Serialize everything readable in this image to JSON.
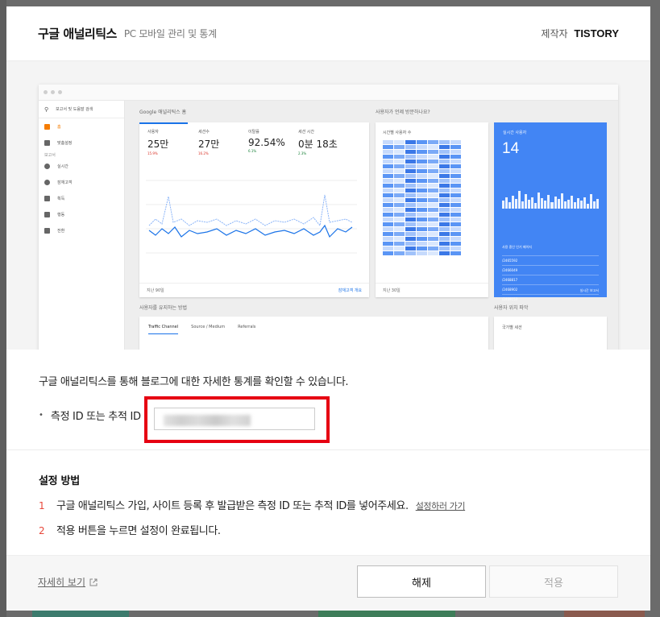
{
  "header": {
    "title": "구글 애널리틱스",
    "subtitle": "PC 모바일 관리 및 통계",
    "author_label": "제작자",
    "author_name": "TISTORY"
  },
  "preview": {
    "search_label": "보고서 및 도움말 검색",
    "side_items": [
      {
        "icon": "home-icon",
        "label": "홈"
      },
      {
        "icon": "customize-icon",
        "label": "맞춤설정"
      }
    ],
    "reports_label": "보고서",
    "report_items": [
      {
        "icon": "clock-icon",
        "label": "실시간"
      },
      {
        "icon": "person-icon",
        "label": "잠재고객"
      },
      {
        "icon": "acquisition-icon",
        "label": "획득"
      },
      {
        "icon": "behavior-icon",
        "label": "행동"
      },
      {
        "icon": "flag-icon",
        "label": "전환"
      }
    ],
    "home_title": "Google 애널리틱스 홈",
    "visit_title": "사용자가 언제 방문하나요?",
    "retain_title": "사용자를 유지하는 방법",
    "location_title": "사용자 위치 파악",
    "metrics": [
      {
        "label": "사용자",
        "value": "25만",
        "delta": "15.9%",
        "up": false
      },
      {
        "label": "세션수",
        "value": "27만",
        "delta": "16.2%",
        "up": false
      },
      {
        "label": "이탈률",
        "value": "92.54%",
        "delta": "6.1%",
        "up": true
      },
      {
        "label": "세션 시간",
        "value": "0분 18초",
        "delta": "2.3%",
        "up": true
      }
    ],
    "home_period": "지난 90일",
    "home_link": "잠재고객 개요",
    "hourly_label": "시간별 사용자 수",
    "heat_period": "지난 30일",
    "realtime_label": "실시간 사용자",
    "realtime_value": "14",
    "realtime_pages_label": "사용 중인 인기 페이지",
    "realtime_pages": [
      "/2465592",
      "/2466049",
      "/2468817",
      "/2468902",
      "/2469153"
    ],
    "realtime_link": "실시간 보고서",
    "tabs": [
      "Traffic Channel",
      "Source / Medium",
      "Referrals"
    ],
    "location_sub": "국가별 세션"
  },
  "form": {
    "description": "구글 애널리틱스를 통해 블로그에 대한 자세한 통계를 확인할 수 있습니다.",
    "bullet": "•",
    "field_label": "측정 ID 또는 추적 ID",
    "field_value": ""
  },
  "howto": {
    "title": "설정 방법",
    "steps": [
      {
        "num": "1",
        "text": "구글 애널리틱스 가입, 사이트 등록 후 발급받은 측정 ID 또는 추적 ID를 넣어주세요.",
        "link": "설정하러 가기"
      },
      {
        "num": "2",
        "text": "적용 버튼을 누르면 설정이 완료됩니다.",
        "link": ""
      }
    ]
  },
  "footer": {
    "more_label": "자세히 보기",
    "cancel_label": "해제",
    "apply_label": "적용"
  },
  "colors": {
    "accent_red": "#e60012",
    "step_number": "#e8483b",
    "ga_blue": "#4285f4",
    "ga_orange": "#f57c00"
  }
}
